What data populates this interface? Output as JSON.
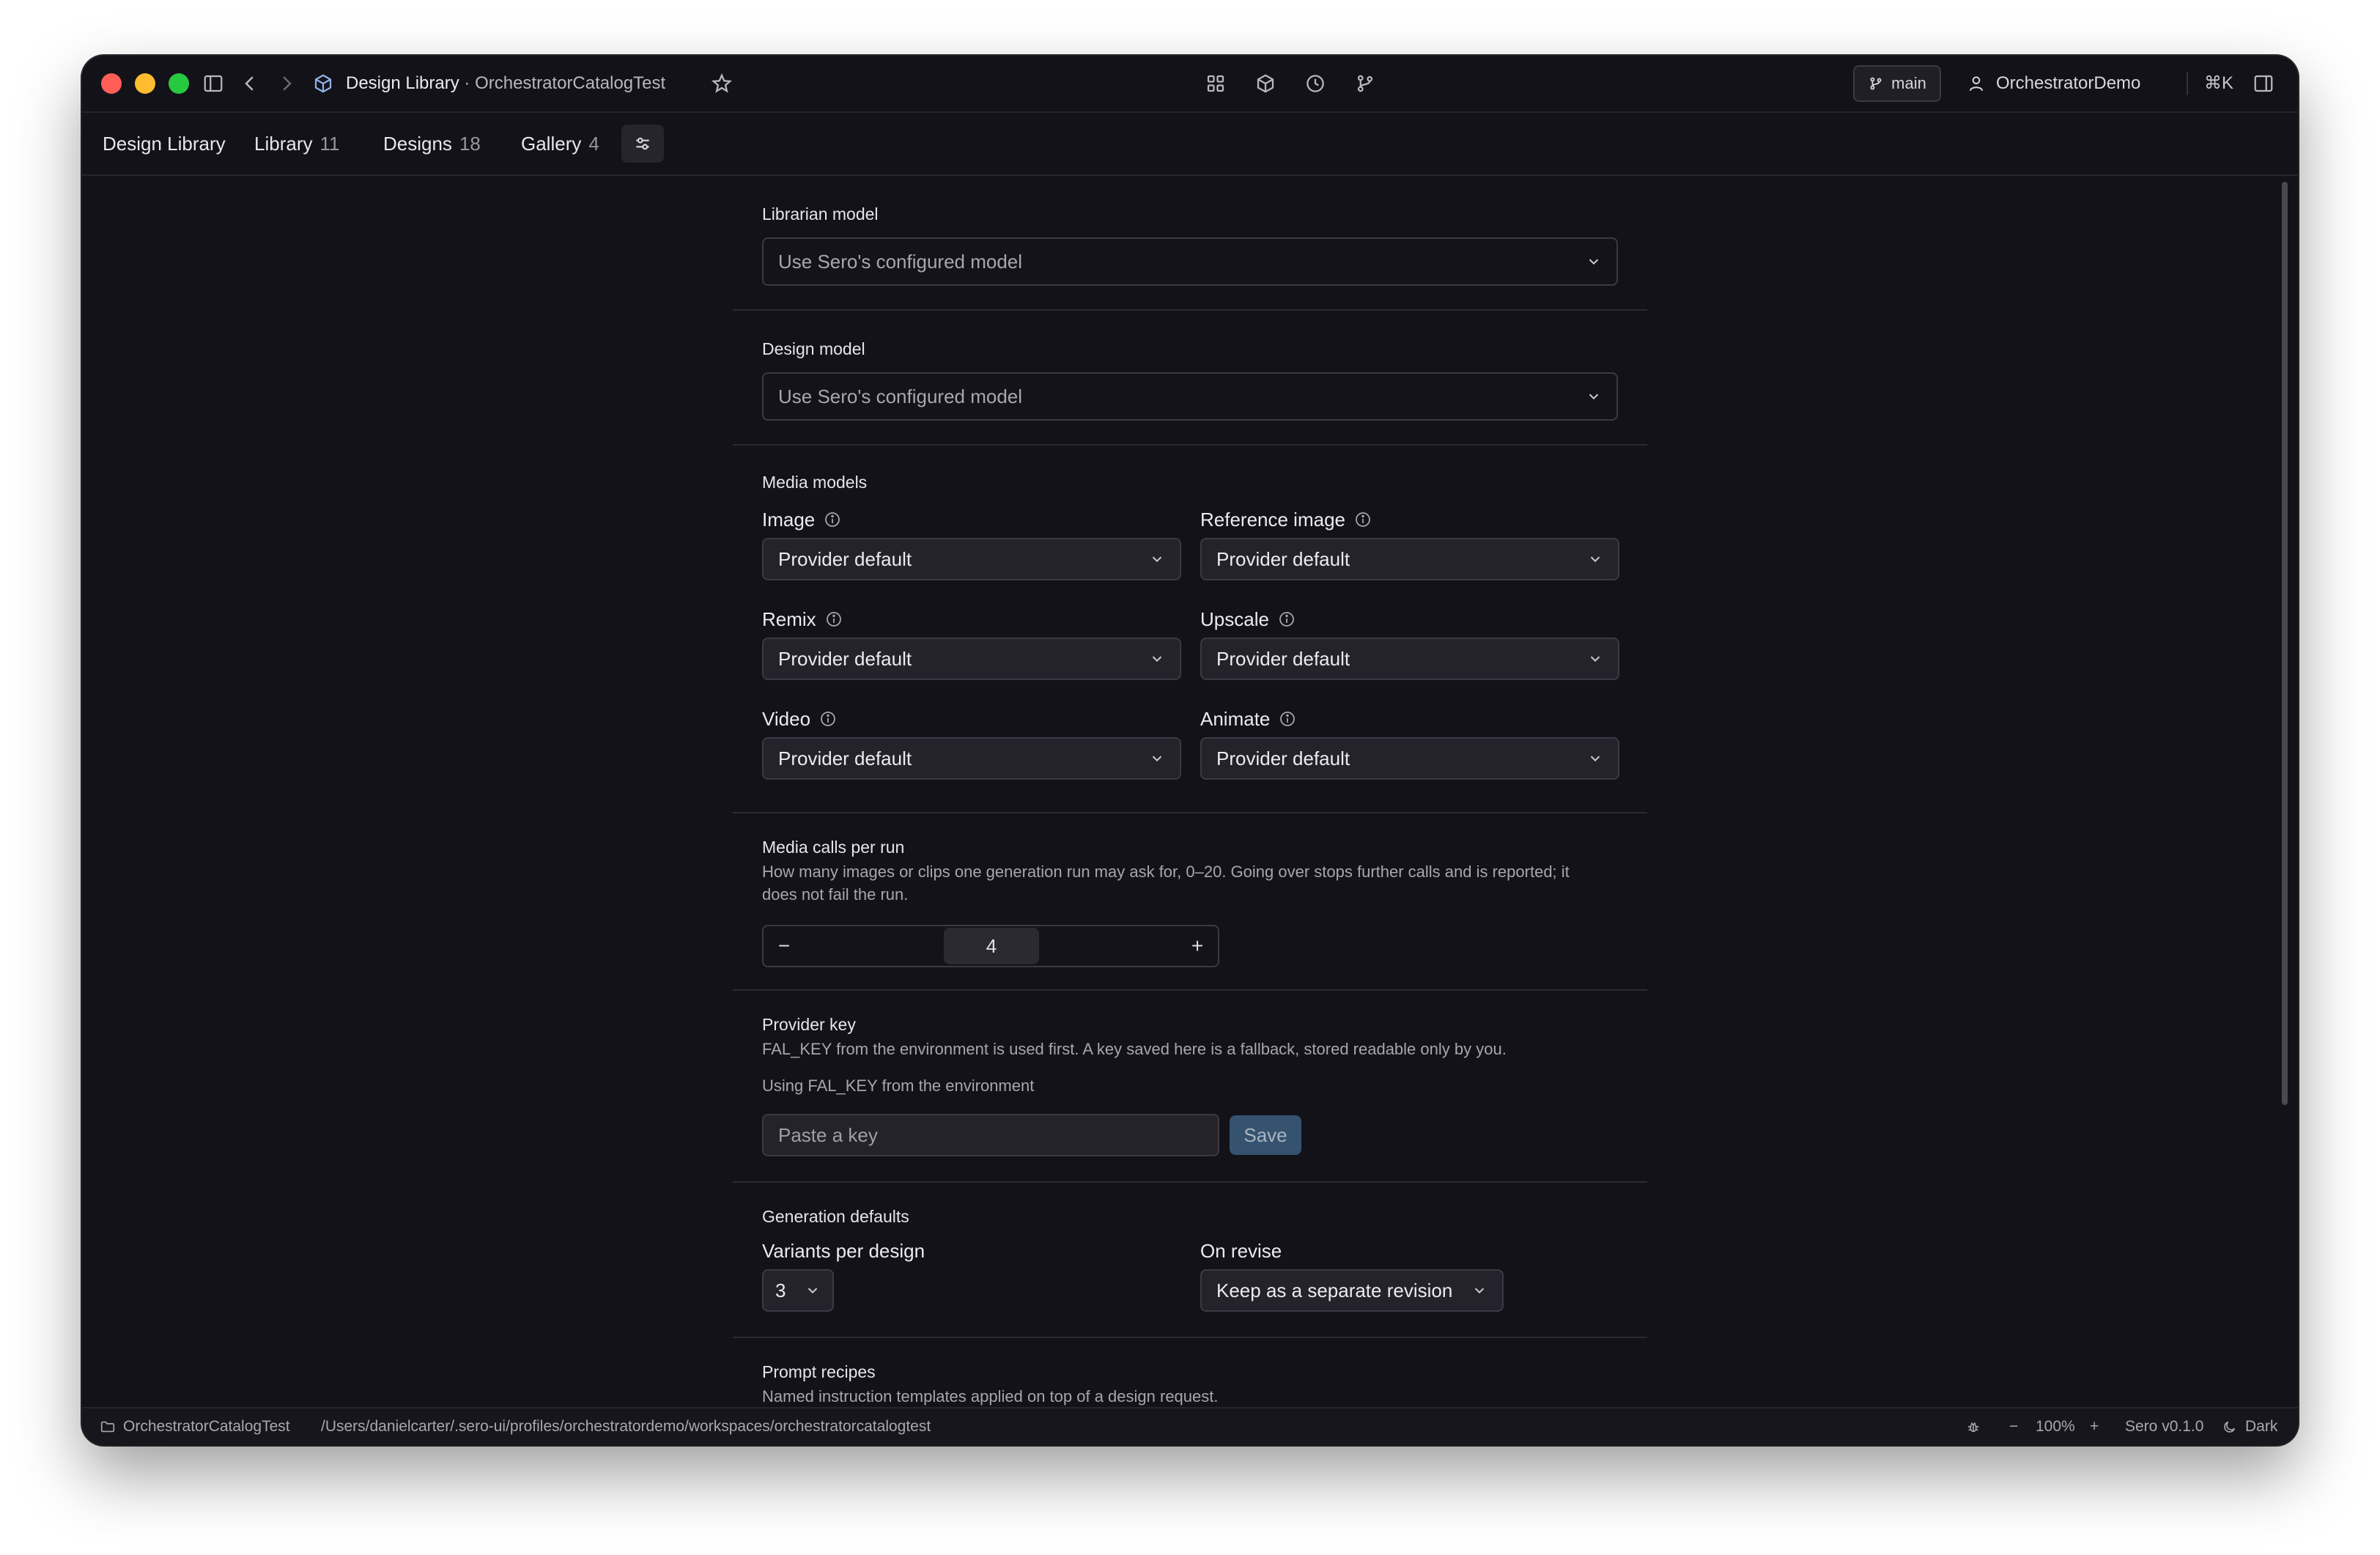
{
  "window": {
    "title": "Design Library",
    "separator": " · ",
    "workspace": "OrchestratorCatalogTest",
    "branch": "main",
    "user": "OrchestratorDemo",
    "shortcut": "⌘K"
  },
  "tabs": [
    {
      "label": "Design Library",
      "count": ""
    },
    {
      "label": "Library",
      "count": "11"
    },
    {
      "label": "Designs",
      "count": "18"
    },
    {
      "label": "Gallery",
      "count": "4"
    }
  ],
  "settings": {
    "librarian": {
      "label": "Librarian model",
      "value": "Use Sero's configured model"
    },
    "design": {
      "label": "Design model",
      "value": "Use Sero's configured model"
    },
    "media": {
      "title": "Media models",
      "fields": [
        {
          "label": "Image",
          "value": "Provider default"
        },
        {
          "label": "Reference image",
          "value": "Provider default"
        },
        {
          "label": "Remix",
          "value": "Provider default"
        },
        {
          "label": "Upscale",
          "value": "Provider default"
        },
        {
          "label": "Video",
          "value": "Provider default"
        },
        {
          "label": "Animate",
          "value": "Provider default"
        }
      ]
    },
    "calls": {
      "title": "Media calls per run",
      "desc": "How many images or clips one generation run may ask for, 0–20. Going over stops further calls and is reported; it does not fail the run.",
      "minus": "−",
      "value": "4",
      "plus": "+"
    },
    "provider": {
      "title": "Provider key",
      "desc": "FAL_KEY from the environment is used first. A key saved here is a fallback, stored readable only by you.",
      "status": "Using FAL_KEY from the environment",
      "placeholder": "Paste a key",
      "save": "Save"
    },
    "generation": {
      "title": "Generation defaults",
      "variants_label": "Variants per design",
      "variants_value": "3",
      "revise_label": "On revise",
      "revise_value": "Keep as a separate revision"
    },
    "recipes": {
      "title": "Prompt recipes",
      "desc": "Named instruction templates applied on top of a design request."
    }
  },
  "status": {
    "workspace": "OrchestratorCatalogTest",
    "path": "/Users/danielcarter/.sero-ui/profiles/orchestratordemo/workspaces/orchestratorcatalogtest",
    "zoom_minus": "−",
    "zoom": "100%",
    "zoom_plus": "+",
    "version": "Sero v0.1.0",
    "theme": "Dark"
  }
}
